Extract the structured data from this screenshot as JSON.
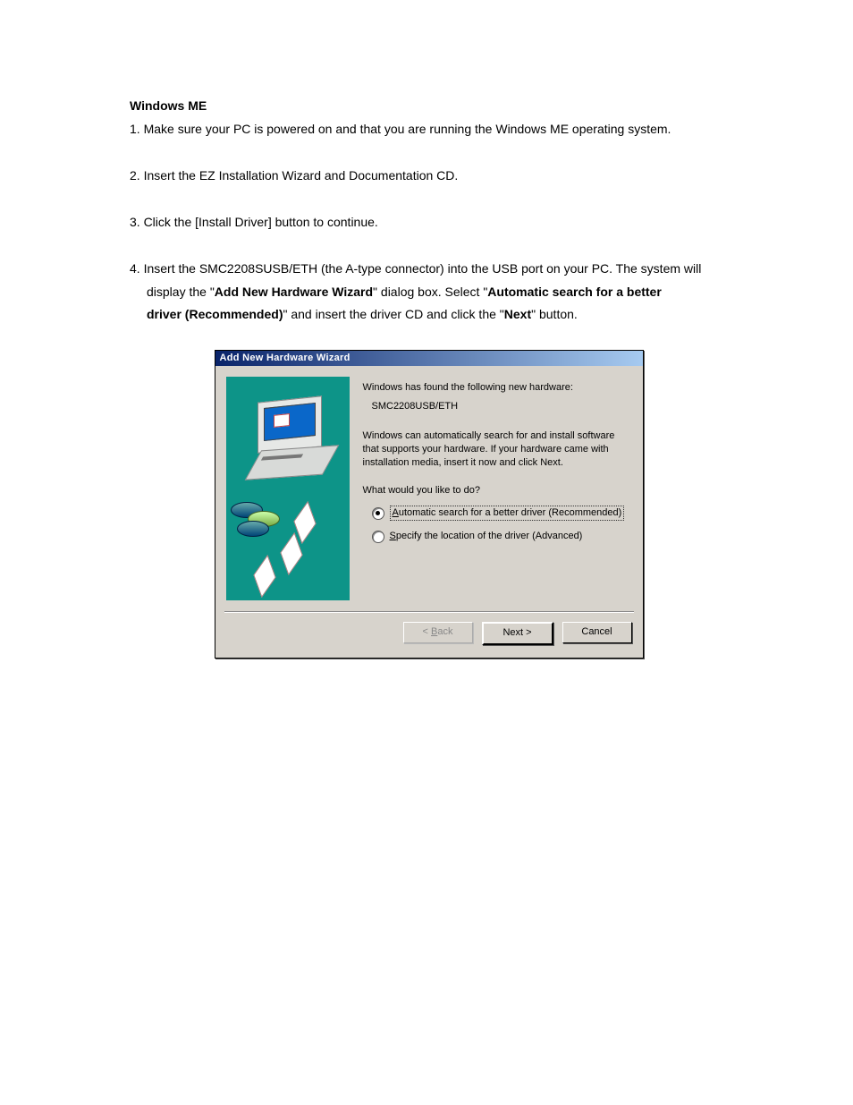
{
  "doc": {
    "heading": "Windows ME",
    "step1": "1. Make sure your PC is powered on and that you are running the Windows ME operating system.",
    "step2": "2. Insert the EZ Installation Wizard and Documentation CD.",
    "step3": "3. Click the [Install Driver] button to continue.",
    "step4_a": "4. Insert the SMC2208SUSB/ETH (the A-type connector) into the USB port on your PC. The system will",
    "step4_b1": "display the \"",
    "step4_b2": "Add New Hardware Wizard",
    "step4_b3": "\" dialog box. Select \"",
    "step4_b4": "Automatic search for a better",
    "step4_c1": "driver (Recommended)",
    "step4_c2": "\" and insert the driver CD and click the \"",
    "step4_c3": "Next",
    "step4_c4": "\" button."
  },
  "dialog": {
    "title": "Add New Hardware Wizard",
    "found": "Windows has found the following new hardware:",
    "device": "SMC2208USB/ETH",
    "desc": "Windows can automatically search for and install software that supports your hardware. If your hardware came with installation media, insert it now and click Next.",
    "prompt": "What would you like to do?",
    "option1_pre": "A",
    "option1_rest": "utomatic search for a better driver (Recommended)",
    "option2_pre": "S",
    "option2_rest": "pecify the location of the driver (Advanced)",
    "back_pre": "< ",
    "back_u": "B",
    "back_rest": "ack",
    "next": "Next >",
    "cancel": "Cancel"
  }
}
